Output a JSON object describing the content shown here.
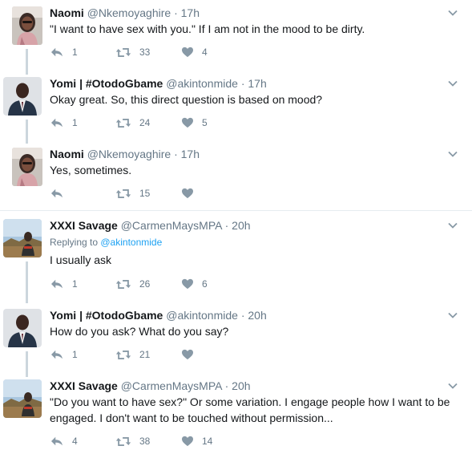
{
  "tweets": [
    {
      "name": "Naomi",
      "handle": "@Nkemoyaghire",
      "time": "17h",
      "reply_to": "",
      "text": "\"I want to have sex with you.\" If I am not in the mood to be dirty.",
      "replies": "1",
      "retweets": "33",
      "likes": "4"
    },
    {
      "name": "Yomi | #OtodoGbame",
      "handle": "@akintonmide",
      "time": "17h",
      "reply_to": "",
      "text": "Okay great. So,  this direct question is based on mood?",
      "replies": "1",
      "retweets": "24",
      "likes": "5"
    },
    {
      "name": "Naomi",
      "handle": "@Nkemoyaghire",
      "time": "17h",
      "reply_to": "",
      "text": "Yes, sometimes.",
      "replies": "",
      "retweets": "15",
      "likes": ""
    },
    {
      "name": "XXXI Savage",
      "handle": "@CarmenMaysMPA",
      "time": "20h",
      "reply_to_prefix": "Replying to ",
      "reply_to": "@akintonmide",
      "text": "I usually ask",
      "replies": "1",
      "retweets": "26",
      "likes": "6"
    },
    {
      "name": "Yomi | #OtodoGbame",
      "handle": "@akintonmide",
      "time": "20h",
      "reply_to": "",
      "text": "How do you ask? What do you say?",
      "replies": "1",
      "retweets": "21",
      "likes": ""
    },
    {
      "name": "XXXI Savage",
      "handle": "@CarmenMaysMPA",
      "time": "20h",
      "reply_to": "",
      "text": "\"Do you want to have sex?\" Or some variation. I engage people how I want to be engaged. I don't want to be touched without permission...",
      "replies": "4",
      "retweets": "38",
      "likes": "14"
    }
  ],
  "separator_dot": "·",
  "icons": {
    "reply": "reply-icon",
    "retweet": "retweet-icon",
    "like": "heart-icon",
    "more": "chevron-down-icon"
  },
  "colors": {
    "action_icon": "#8899a6",
    "link": "#1da1f2",
    "thread_line": "#ccd6dd"
  }
}
